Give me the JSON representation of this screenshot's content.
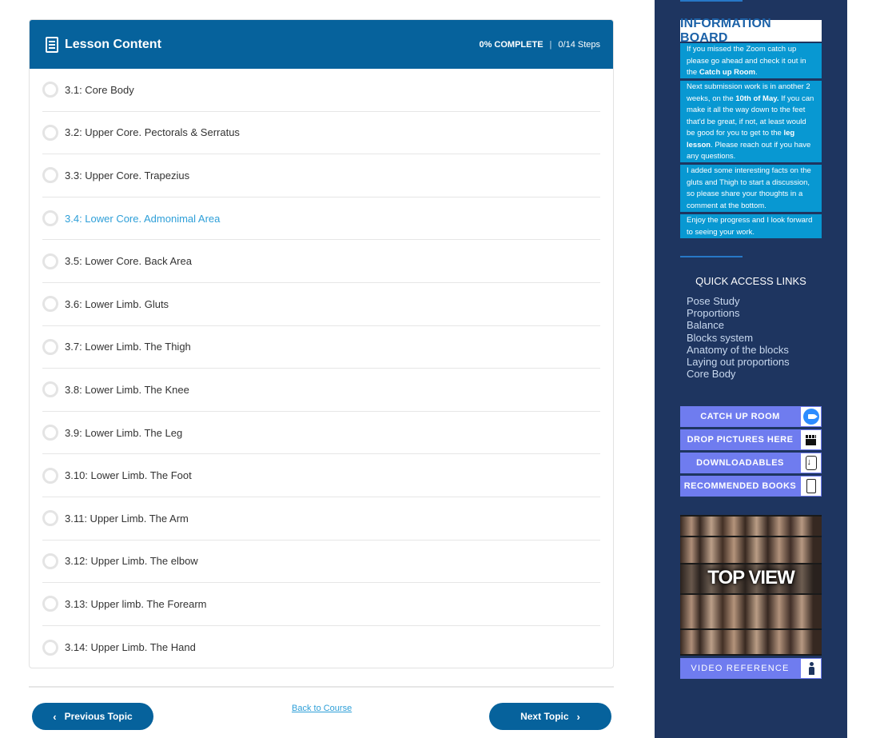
{
  "lesson": {
    "title": "Lesson Content",
    "progress_percent": "0% COMPLETE",
    "progress_separator": "|",
    "steps": "0/14 Steps",
    "items": [
      {
        "label": "3.1: Core Body",
        "active": false
      },
      {
        "label": "3.2: Upper Core. Pectorals & Serratus",
        "active": false
      },
      {
        "label": "3.3: Upper Core. Trapezius",
        "active": false
      },
      {
        "label": "3.4: Lower Core. Admonimal Area",
        "active": true
      },
      {
        "label": "3.5: Lower Core. Back Area",
        "active": false
      },
      {
        "label": "3.6: Lower Limb. Gluts",
        "active": false
      },
      {
        "label": "3.7: Lower Limb. The Thigh",
        "active": false
      },
      {
        "label": "3.8: Lower Limb. The Knee",
        "active": false
      },
      {
        "label": "3.9: Lower Limb. The Leg",
        "active": false
      },
      {
        "label": "3.10: Lower Limb. The Foot",
        "active": false
      },
      {
        "label": "3.11: Upper Limb. The Arm",
        "active": false
      },
      {
        "label": "3.12: Upper Limb. The elbow",
        "active": false
      },
      {
        "label": "3.13: Upper limb. The Forearm",
        "active": false
      },
      {
        "label": "3.14: Upper Limb. The Hand",
        "active": false
      }
    ]
  },
  "nav": {
    "previous_label": "Previous Topic",
    "next_label": "Next Topic",
    "back_label": "Back to Course"
  },
  "sidebar": {
    "info_title": "INFORMATION BOARD",
    "info_1": {
      "a": "If you missed the Zoom catch up please go ahead and check it out in the ",
      "b": "Catch up Room",
      "c": "."
    },
    "info_2": {
      "a": "Next submission work is in another 2 weeks, on the ",
      "b": "10th of May.",
      "c": " If you can make it all the way down to the feet that'd be great, if not, at least would be good for you to get to the ",
      "d": "leg lesson",
      "e": ". Please reach out if you have any questions."
    },
    "info_3": "I added some interesting facts on the gluts and Thigh to start a discussion, so please share your thoughts in a comment at the bottom.",
    "info_4": "Enjoy the progress and I look forward to seeing your work.",
    "quick_title": "QUICK ACCESS LINKS",
    "quick_links": [
      "Pose Study",
      "Proportions",
      "Balance",
      "Blocks system",
      "Anatomy of the blocks",
      "Laying out proportions",
      "Core Body"
    ],
    "buttons": {
      "catch_up": "CATCH UP ROOM",
      "drop_pictures": "DROP PICTURES HERE",
      "downloadables": "DOWNLOADABLES",
      "books": "RECOMMENDED BOOKS",
      "video_ref": "VIDEO REFERENCE"
    },
    "ref_image_text": "TOP VIEW"
  },
  "colors": {
    "header_blue": "#06629c",
    "active_link": "#2e9fd8",
    "sidebar_bg": "#1e3560",
    "info_block": "#0898d2",
    "side_button": "#6f7cef"
  }
}
